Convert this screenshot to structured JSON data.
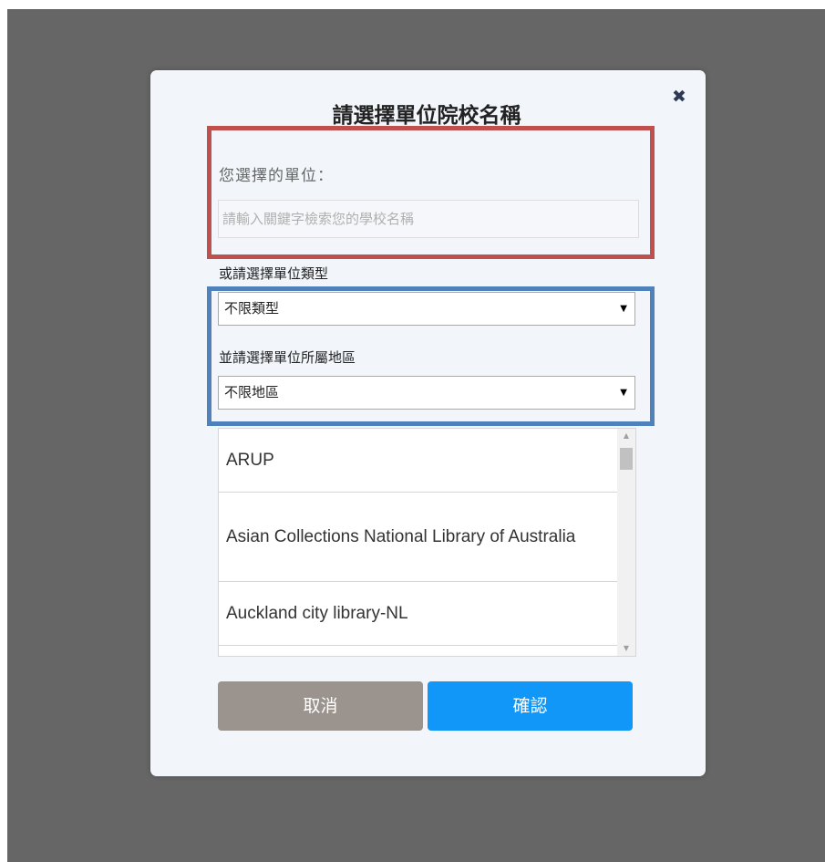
{
  "dialog": {
    "title": "請選擇單位院校名稱",
    "close_icon": "✖"
  },
  "selection": {
    "label": "您選擇的單位：",
    "search_placeholder": "請輸入關鍵字檢索您的學校名稱",
    "search_value": ""
  },
  "filters": {
    "type_label": "或請選擇單位類型",
    "type_selected": "不限類型",
    "region_label": "並請選擇單位所屬地區",
    "region_selected": "不限地區"
  },
  "institutions": [
    "ARUP",
    "Asian Collections National Library of Australia",
    "Auckland city library-NL",
    ""
  ],
  "buttons": {
    "cancel": "取消",
    "confirm": "確認"
  },
  "colors": {
    "overlay": "#666666",
    "red_frame": "#c0504d",
    "blue_frame": "#4f81bd",
    "cancel_button": "#9a938e",
    "confirm_button": "#1097f7"
  }
}
